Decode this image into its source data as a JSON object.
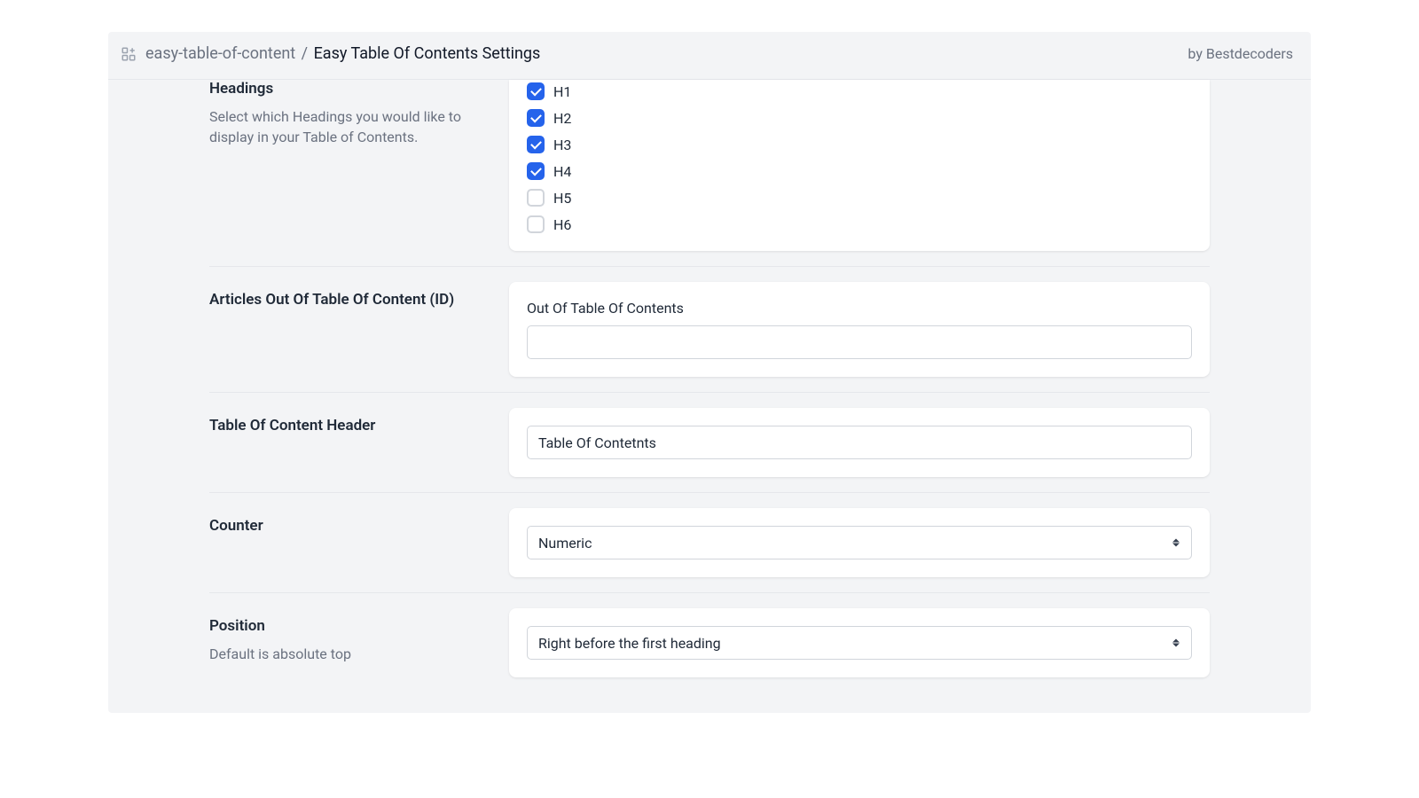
{
  "header": {
    "breadcrumb_slug": "easy-table-of-content",
    "breadcrumb_current": "Easy Table Of Contents Settings",
    "byline_prefix": "by ",
    "byline_author": "Bestdecoders"
  },
  "headings": {
    "title": "Headings",
    "description": "Select which Headings you would like to display in your Table of Contents.",
    "options": [
      {
        "label": "H1",
        "checked": true
      },
      {
        "label": "H2",
        "checked": true
      },
      {
        "label": "H3",
        "checked": true
      },
      {
        "label": "H4",
        "checked": true
      },
      {
        "label": "H5",
        "checked": false
      },
      {
        "label": "H6",
        "checked": false
      }
    ]
  },
  "articles_out": {
    "title": "Articles Out Of Table Of Content (ID)",
    "field_label": "Out Of Table Of Contents",
    "value": ""
  },
  "toc_header": {
    "title": "Table Of Content Header",
    "value": "Table Of Contetnts"
  },
  "counter": {
    "title": "Counter",
    "value": "Numeric"
  },
  "position": {
    "title": "Position",
    "description": "Default is absolute top",
    "value": "Right before the first heading"
  }
}
